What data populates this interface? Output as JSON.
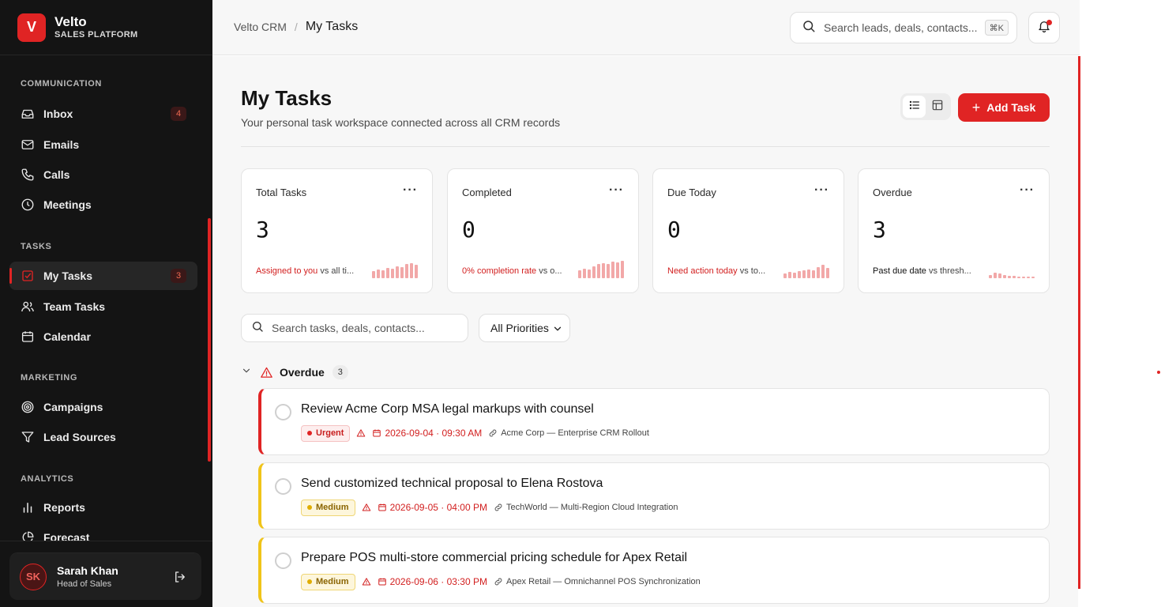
{
  "brand": {
    "logo_letter": "V",
    "name": "Velto",
    "subtitle": "SALES PLATFORM",
    "accent": "#e02424"
  },
  "sidebar": {
    "sections": [
      {
        "title": "COMMUNICATION"
      },
      {
        "title": "TASKS"
      },
      {
        "title": "MARKETING"
      },
      {
        "title": "ANALYTICS"
      }
    ],
    "items": [
      {
        "label": "Inbox",
        "icon": "inbox-icon",
        "badge": "4"
      },
      {
        "label": "Emails",
        "icon": "mail-icon"
      },
      {
        "label": "Calls",
        "icon": "phone-icon"
      },
      {
        "label": "Meetings",
        "icon": "clock-icon"
      },
      {
        "label": "My Tasks",
        "icon": "checkbox-icon",
        "badge": "3",
        "active": true
      },
      {
        "label": "Team Tasks",
        "icon": "users-icon"
      },
      {
        "label": "Calendar",
        "icon": "calendar-icon"
      },
      {
        "label": "Campaigns",
        "icon": "target-icon"
      },
      {
        "label": "Lead Sources",
        "icon": "filter-icon"
      },
      {
        "label": "Reports",
        "icon": "bar-chart-icon"
      },
      {
        "label": "Forecast",
        "icon": "pie-chart-icon"
      }
    ],
    "user": {
      "initials": "SK",
      "name": "Sarah Khan",
      "role": "Head of Sales"
    }
  },
  "topbar": {
    "breadcrumb_root": "Velto CRM",
    "breadcrumb_sep": "/",
    "breadcrumb_current": "My Tasks",
    "search_placeholder": "Search leads, deals, contacts...",
    "shortcut": "⌘K"
  },
  "page": {
    "title": "My Tasks",
    "subtitle": "Your personal task workspace connected across all CRM records",
    "add_button": "Add Task"
  },
  "stats": [
    {
      "label": "Total Tasks",
      "value": "3",
      "highlight": "Assigned to you",
      "rest": " vs all ti...",
      "spark": [
        0.4,
        0.5,
        0.45,
        0.6,
        0.55,
        0.7,
        0.65,
        0.8,
        0.85,
        0.75
      ]
    },
    {
      "label": "Completed",
      "value": "0",
      "highlight": "0% completion rate",
      "rest": " vs o...",
      "spark": [
        0.45,
        0.55,
        0.5,
        0.7,
        0.8,
        0.85,
        0.8,
        0.95,
        0.9,
        1.0
      ]
    },
    {
      "label": "Due Today",
      "value": "0",
      "highlight": "Need action today",
      "rest": " vs to...",
      "spark": [
        0.25,
        0.35,
        0.3,
        0.4,
        0.45,
        0.5,
        0.45,
        0.65,
        0.75,
        0.6
      ]
    },
    {
      "label": "Overdue",
      "value": "3",
      "highlight": "Past due date",
      "rest": " vs thresh...",
      "spark": [
        0.2,
        0.3,
        0.25,
        0.2,
        0.15,
        0.12,
        0.1,
        0.1,
        0.08,
        0.08
      ]
    }
  ],
  "filters": {
    "search_placeholder": "Search tasks, deals, contacts...",
    "priority": "All Priorities"
  },
  "group": {
    "label": "Overdue",
    "count": "3"
  },
  "tasks": [
    {
      "title": "Review Acme Corp MSA legal markups with counsel",
      "priority": "Urgent",
      "due": "2026-09-04 · 09:30 AM",
      "link": "Acme Corp — Enterprise CRM Rollout"
    },
    {
      "title": "Send customized technical proposal to Elena Rostova",
      "priority": "Medium",
      "due": "2026-09-05 · 04:00 PM",
      "link": "TechWorld — Multi-Region Cloud Integration"
    },
    {
      "title": "Prepare POS multi-store commercial pricing schedule for Apex Retail",
      "priority": "Medium",
      "due": "2026-09-06 · 03:30 PM",
      "link": "Apex Retail — Omnichannel POS Synchronization"
    }
  ]
}
